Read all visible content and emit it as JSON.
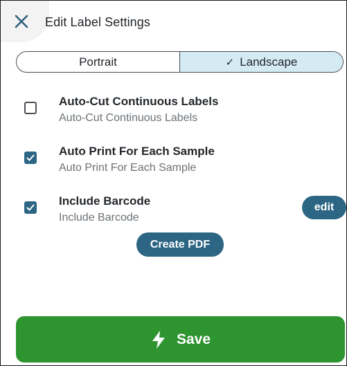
{
  "header": {
    "title": "Edit Label Settings",
    "close_icon": "close-icon"
  },
  "orientation": {
    "options": [
      {
        "label": "Portrait",
        "selected": false
      },
      {
        "label": "Landscape",
        "selected": true
      }
    ],
    "check_glyph": "✓",
    "selected_color": "#d4ebf4"
  },
  "options": [
    {
      "title": "Auto-Cut Continuous Labels",
      "subtitle": "Auto-Cut Continuous Labels",
      "checked": false
    },
    {
      "title": "Auto Print For Each Sample",
      "subtitle": "Auto Print For Each Sample",
      "checked": true
    },
    {
      "title": "Include Barcode",
      "subtitle": "Include Barcode",
      "checked": true
    }
  ],
  "barcode_edit_label": "edit",
  "create_pdf_label": "Create PDF",
  "save": {
    "label": "Save",
    "icon": "lightning-bolt-icon",
    "color": "#2e9430"
  },
  "accent_color": "#2c6684"
}
